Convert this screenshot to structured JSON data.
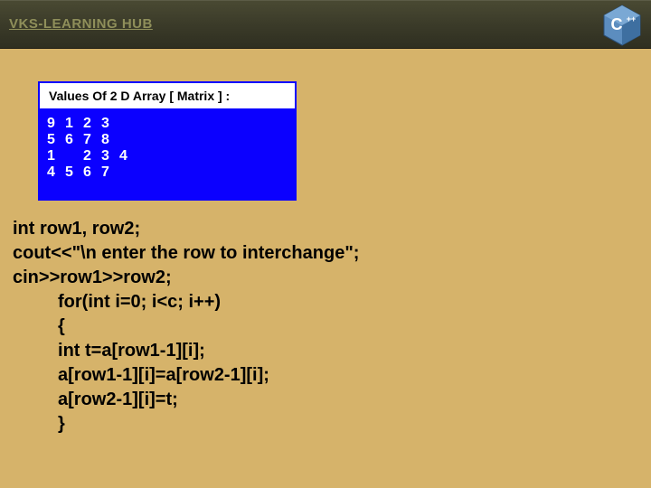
{
  "header": {
    "brand": "VKS-LEARNING HUB",
    "logo_label": "C++"
  },
  "panel": {
    "title": "Values Of 2 D Array [ Matrix ] :",
    "matrix": [
      [
        "9",
        "1",
        "2",
        "3"
      ],
      [
        "5",
        "6",
        "7",
        "8"
      ],
      [
        "1",
        "",
        "2",
        "3",
        "4"
      ],
      [
        "4",
        "5",
        "6",
        "7"
      ]
    ]
  },
  "code": {
    "lines": [
      "int row1, row2;",
      "cout<<\"\\n enter the row to interchange\";",
      "cin>>row1>>row2;",
      "         for(int i=0; i<c; i++)",
      "         {",
      "         int t=a[row1-1][i];",
      "         a[row1-1][i]=a[row2-1][i];",
      "         a[row2-1][i]=t;",
      "         }"
    ]
  }
}
